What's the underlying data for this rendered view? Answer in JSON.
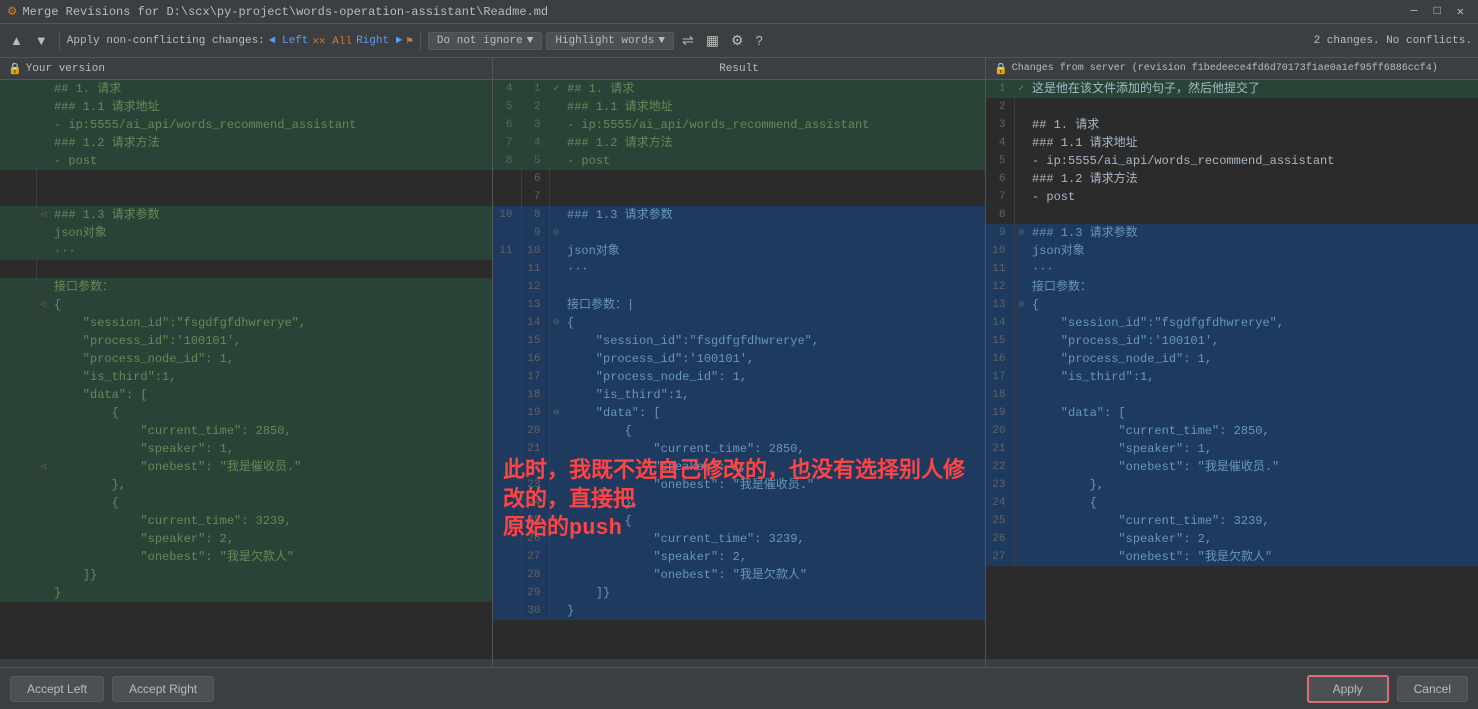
{
  "titleBar": {
    "icon": "⚙",
    "title": "Merge Revisions for D:\\scx\\py-project\\words-operation-assistant\\Readme.md"
  },
  "toolbar": {
    "upArrow": "▲",
    "downArrow": "▼",
    "applyNonConflicting": "Apply non-conflicting changes:",
    "leftLabel": "Left",
    "allLabel": "All",
    "rightLabel": "Right",
    "doNotIgnore": "Do not ignore",
    "highlightWords": "Highlight words",
    "helpIcon": "?",
    "changesInfo": "2 changes. No conflicts."
  },
  "panels": {
    "left": {
      "header": "🔒 Your version",
      "lockIcon": "🔒"
    },
    "center": {
      "header": "Result"
    },
    "right": {
      "header": "🔒 Changes from server (revision f1bedeece4fd6d70173f1ae0a1ef95ff6886ccf4)",
      "lockIcon": "🔒"
    }
  },
  "overlayText": "此时，我既不选自己修改的，也没有选择别人修改的，直接把原始的push",
  "buttons": {
    "acceptLeft": "Accept Left",
    "acceptRight": "Accept Right",
    "apply": "Apply",
    "cancel": "Cancel"
  },
  "leftLines": [
    {
      "num": "",
      "code": "## 1. 请求"
    },
    {
      "num": "",
      "code": "### 1.1 请求地址"
    },
    {
      "num": "",
      "code": "- ip:5555/ai_api/words_recommend_assistant"
    },
    {
      "num": "",
      "code": "### 1.2 请求方法"
    },
    {
      "num": "",
      "code": "- post"
    },
    {
      "num": "",
      "code": ""
    },
    {
      "num": "",
      "code": ""
    },
    {
      "num": "",
      "code": "### 1.3 请求参数"
    },
    {
      "num": "",
      "code": "json对象"
    },
    {
      "num": "",
      "code": "···"
    },
    {
      "num": "",
      "code": ""
    },
    {
      "num": "",
      "code": "接口参数："
    },
    {
      "num": "",
      "code": "{"
    },
    {
      "num": "",
      "code": "    \"session_id\":\"fsgdfgfdhwrerye\","
    },
    {
      "num": "",
      "code": "    \"process_id\":'100101',"
    },
    {
      "num": "",
      "code": "    \"process_node_id\": 1,"
    },
    {
      "num": "",
      "code": "    \"is_third\":1,"
    },
    {
      "num": "",
      "code": "    \"data\": ["
    },
    {
      "num": "",
      "code": "        {"
    },
    {
      "num": "",
      "code": "            \"current_time\": 2850,"
    },
    {
      "num": "",
      "code": "            \"speaker\": 1,"
    },
    {
      "num": "",
      "code": "            \"onebest\": \"我是催收员.\""
    },
    {
      "num": "",
      "code": "        },"
    },
    {
      "num": "",
      "code": "        {"
    },
    {
      "num": "",
      "code": "            \"current_time\": 3239,"
    },
    {
      "num": "",
      "code": "            \"speaker\": 2,"
    },
    {
      "num": "",
      "code": "            \"onebest\": \"我是欠款人\""
    },
    {
      "num": "",
      "code": "    ]}"
    },
    {
      "num": "",
      "code": "}"
    }
  ],
  "centerLines": [
    {
      "num": "1",
      "lnum": "4",
      "code": "## 1. 请求",
      "mark": "✓"
    },
    {
      "num": "2",
      "lnum": "5",
      "code": "### 1.1 请求地址"
    },
    {
      "num": "3",
      "lnum": "6",
      "code": "- ip:5555/ai_api/words_recommend_assistant"
    },
    {
      "num": "4",
      "lnum": "7",
      "code": "### 1.2 请求方法"
    },
    {
      "num": "5",
      "lnum": "8",
      "code": "- post"
    },
    {
      "num": "6",
      "lnum": "",
      "code": ""
    },
    {
      "num": "7",
      "lnum": "",
      "code": ""
    },
    {
      "num": "8",
      "lnum": "10",
      "code": "### 1.3 请求参数"
    },
    {
      "num": "9",
      "lnum": "",
      "code": ""
    },
    {
      "num": "10",
      "lnum": "11",
      "code": "json对象"
    },
    {
      "num": "11",
      "lnum": "",
      "code": "···"
    },
    {
      "num": "12",
      "lnum": "",
      "code": ""
    },
    {
      "num": "13",
      "lnum": "",
      "code": "接口参数：|"
    },
    {
      "num": "14",
      "lnum": "",
      "code": "{"
    },
    {
      "num": "15",
      "lnum": "",
      "code": "    \"session_id\":\"fsgdfgfdhwrerye\","
    },
    {
      "num": "16",
      "lnum": "",
      "code": "    \"process_id\":'100101',"
    },
    {
      "num": "17",
      "lnum": "",
      "code": "    \"process_node_id\": 1,"
    },
    {
      "num": "18",
      "lnum": "",
      "code": "    \"is_third\":1,"
    },
    {
      "num": "19",
      "lnum": "",
      "code": "    \"data\": ["
    },
    {
      "num": "20",
      "lnum": "",
      "code": "        {"
    },
    {
      "num": "21",
      "lnum": "",
      "code": "            \"current_time\": 2850,"
    },
    {
      "num": "22",
      "lnum": "",
      "code": "            \"speaker\": 1,"
    },
    {
      "num": "23",
      "lnum": "",
      "code": "            \"onebest\": \"我是催收员.\""
    },
    {
      "num": "24",
      "lnum": "",
      "code": "        },"
    },
    {
      "num": "25",
      "lnum": "",
      "code": "        {"
    },
    {
      "num": "26",
      "lnum": "",
      "code": "            \"current_time\": 3239,"
    },
    {
      "num": "27",
      "lnum": "",
      "code": "            \"speaker\": 2,"
    },
    {
      "num": "28",
      "lnum": "",
      "code": "            \"onebest\": \"我是欠款人\""
    },
    {
      "num": "29",
      "lnum": "",
      "code": "    ]}"
    },
    {
      "num": "30",
      "lnum": "",
      "code": "}"
    }
  ],
  "rightLines": [
    {
      "num": "1",
      "code": "这是他在该文件添加的句子，然后他提交了",
      "mark": "✓"
    },
    {
      "num": "2",
      "code": ""
    },
    {
      "num": "3",
      "code": "## 1. 请求"
    },
    {
      "num": "4",
      "code": "### 1.1 请求地址"
    },
    {
      "num": "5",
      "code": "- ip:5555/ai_api/words_recommend_assistant"
    },
    {
      "num": "6",
      "code": "### 1.2 请求方法"
    },
    {
      "num": "7",
      "code": "- post"
    },
    {
      "num": "8",
      "code": ""
    },
    {
      "num": "9",
      "code": "### 1.3 请求参数"
    },
    {
      "num": "10",
      "code": "json对象"
    },
    {
      "num": "11",
      "code": "···"
    },
    {
      "num": "12",
      "code": "接口参数："
    },
    {
      "num": "13",
      "code": "{"
    },
    {
      "num": "14",
      "code": "    \"session_id\":\"fsgdfgfdhwrerye\","
    },
    {
      "num": "15",
      "code": "    \"process_id\":'100101',"
    },
    {
      "num": "16",
      "code": "    \"process_node_id\": 1,"
    },
    {
      "num": "17",
      "code": "    \"is_third\":1,"
    },
    {
      "num": "18",
      "code": ""
    },
    {
      "num": "19",
      "code": "    \"data\": ["
    },
    {
      "num": "20",
      "code": "            \"current_time\": 2850,"
    },
    {
      "num": "21",
      "code": "            \"speaker\": 1,"
    },
    {
      "num": "22",
      "code": "            \"onebest\": \"我是催收员.\""
    },
    {
      "num": "23",
      "code": "        },"
    },
    {
      "num": "24",
      "code": "        {"
    },
    {
      "num": "25",
      "code": "            \"current_time\": 3239,"
    },
    {
      "num": "26",
      "code": "            \"speaker\": 2,"
    },
    {
      "num": "27",
      "code": "            \"onebest\": \"我是欠款人\""
    }
  ]
}
